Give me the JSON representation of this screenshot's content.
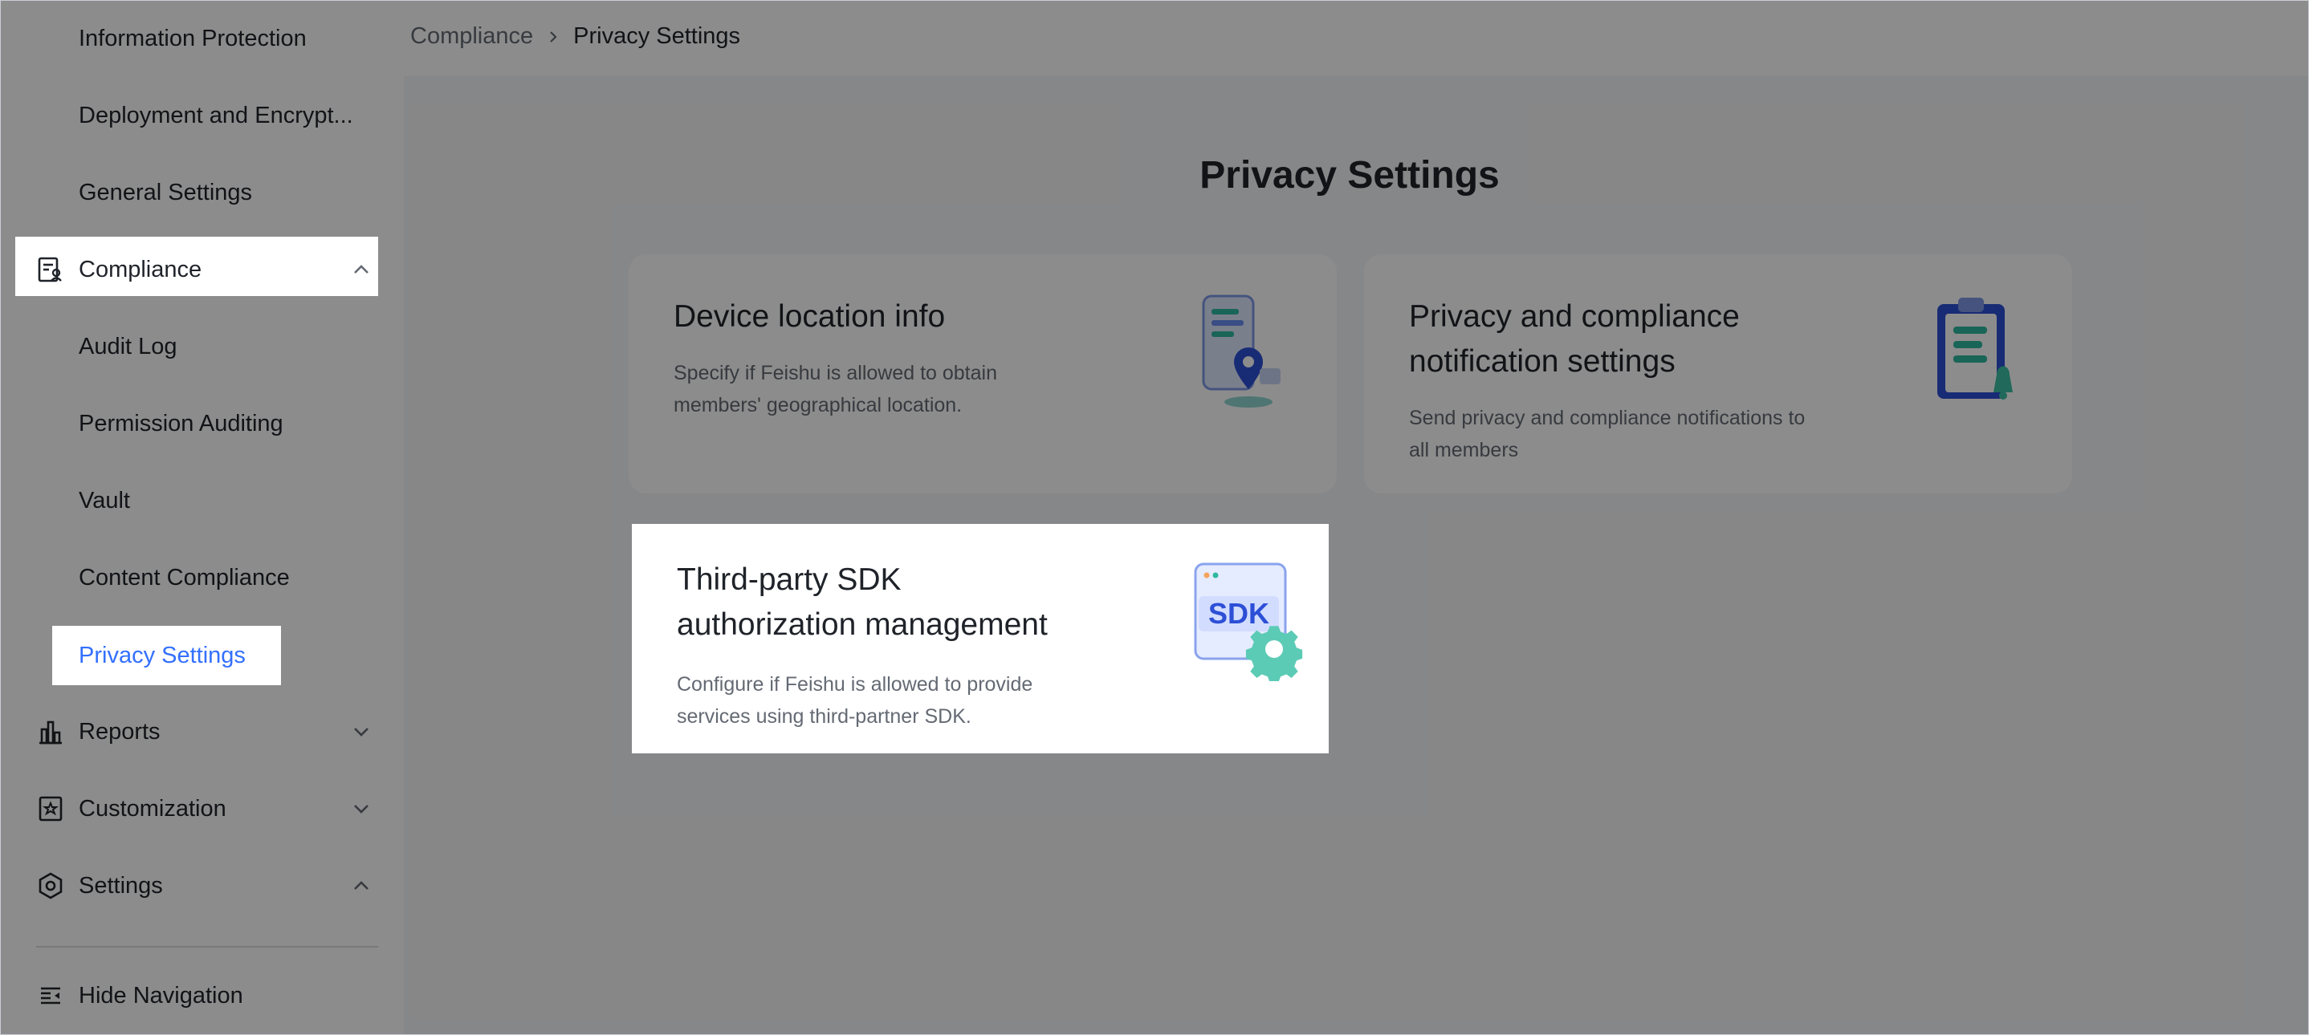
{
  "sidebar": {
    "items": [
      {
        "label": "Information Protection"
      },
      {
        "label": "Deployment and Encrypt..."
      },
      {
        "label": "General Settings"
      },
      {
        "label": "Compliance"
      },
      {
        "label": "Audit Log"
      },
      {
        "label": "Permission Auditing"
      },
      {
        "label": "Vault"
      },
      {
        "label": "Content Compliance"
      },
      {
        "label": "Privacy Settings"
      },
      {
        "label": "Reports"
      },
      {
        "label": "Customization"
      },
      {
        "label": "Settings"
      }
    ],
    "hide_nav_label": "Hide Navigation"
  },
  "breadcrumb": {
    "parent": "Compliance",
    "current": "Privacy Settings"
  },
  "page": {
    "title": "Privacy Settings"
  },
  "cards": [
    {
      "title": "Device location info",
      "description_line1": "Specify if Feishu is allowed to obtain",
      "description_line2": "members' geographical location.",
      "icon": "phone-location-icon"
    },
    {
      "title_line1": "Privacy and compliance",
      "title_line2": "notification settings",
      "description_line1": "Send privacy and compliance notifications to",
      "description_line2": "all members",
      "icon": "clipboard-bell-icon"
    },
    {
      "title_line1": "Third-party SDK",
      "title_line2": "authorization management",
      "description_line1": "Configure if Feishu is allowed to provide",
      "description_line2": "services using third-partner SDK.",
      "icon": "sdk-gear-icon",
      "icon_text": "SDK"
    }
  ],
  "colors": {
    "accent": "#3370ff",
    "text_primary": "#1f2329",
    "text_secondary": "#646a73"
  }
}
